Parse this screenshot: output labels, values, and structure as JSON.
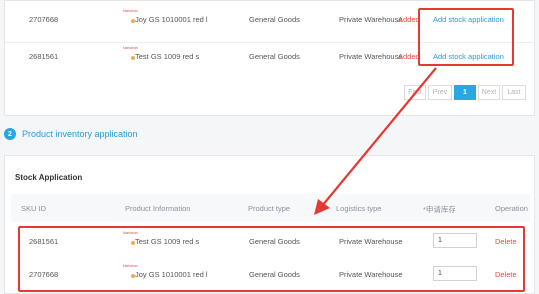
{
  "top_table": {
    "rows": [
      {
        "sku": "2707668",
        "brand": "Markstrom",
        "name": "Joy GS 1010001 red l",
        "type": "General Goods",
        "logistics": "Private Warehouse",
        "status": "Added",
        "action": "Add stock application"
      },
      {
        "sku": "2681561",
        "brand": "Markstrom",
        "name": "Test GS 1009 red s",
        "type": "General Goods",
        "logistics": "Private Warehouse",
        "status": "Added",
        "action": "Add stock application"
      }
    ]
  },
  "pagination": {
    "first": "First",
    "prev": "Prev",
    "current": "1",
    "next": "Next",
    "last": "Last"
  },
  "section": {
    "number": "2",
    "title": "Product inventory application"
  },
  "stock_application": {
    "title": "Stock Application",
    "headers": {
      "sku": "SKU ID",
      "info": "Product Information",
      "type": "Product type",
      "logistics": "Logistics type",
      "qty": "*申请库存",
      "op": "Operation"
    },
    "rows": [
      {
        "sku": "2681561",
        "brand": "Markstrom",
        "name": "Test GS 1009 red s",
        "type": "General Goods",
        "logistics": "Private Warehouse",
        "qty": "1",
        "op": "Delete"
      },
      {
        "sku": "2707668",
        "brand": "Markstrom",
        "name": "Joy GS 1010001 red l",
        "type": "General Goods",
        "logistics": "Private Warehouse",
        "qty": "1",
        "op": "Delete"
      }
    ]
  },
  "colors": {
    "accent": "#29a7e1",
    "highlight": "#e53935",
    "added": "#e74c3c"
  }
}
